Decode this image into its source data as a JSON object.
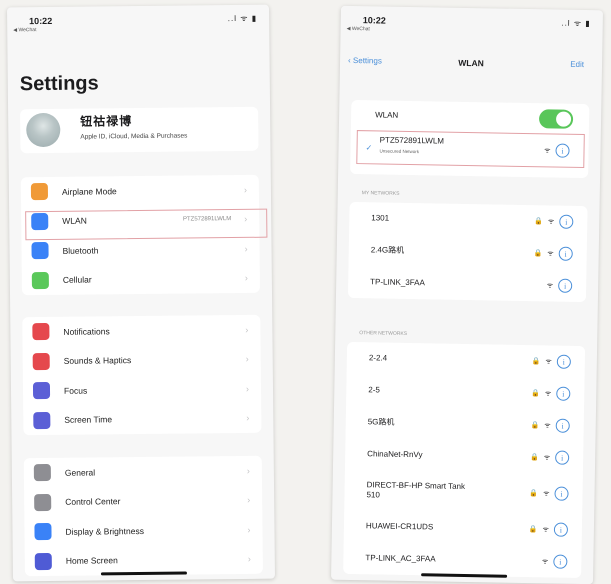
{
  "left": {
    "status": {
      "time": "10:22",
      "carrier": "◀ WeChat",
      "icons": "..l ᯤ ▮"
    },
    "title": "Settings",
    "profile": {
      "name": "钮祜禄博",
      "subtitle": "Apple ID, iCloud, Media & Purchases"
    },
    "groups": [
      [
        {
          "label": "Airplane Mode",
          "icon": "airplane-icon",
          "color": "#f09a37"
        },
        {
          "label": "WLAN",
          "icon": "wifi-icon",
          "color": "#3a82f7",
          "value": "PTZ572891LWLM"
        },
        {
          "label": "Bluetooth",
          "icon": "bluetooth-icon",
          "color": "#3a82f7"
        },
        {
          "label": "Cellular",
          "icon": "antenna-icon",
          "color": "#5ac85a"
        }
      ],
      [
        {
          "label": "Notifications",
          "icon": "bell-icon",
          "color": "#e5484d"
        },
        {
          "label": "Sounds & Haptics",
          "icon": "speaker-icon",
          "color": "#e5484d"
        },
        {
          "label": "Focus",
          "icon": "moon-icon",
          "color": "#5b5fd6"
        },
        {
          "label": "Screen Time",
          "icon": "hourglass-icon",
          "color": "#5b5fd6"
        }
      ],
      [
        {
          "label": "General",
          "icon": "gear-icon",
          "color": "#8e8e93"
        },
        {
          "label": "Control Center",
          "icon": "switches-icon",
          "color": "#8e8e93"
        },
        {
          "label": "Display & Brightness",
          "icon": "aa-icon",
          "color": "#3a82f7"
        },
        {
          "label": "Home Screen",
          "icon": "grid-icon",
          "color": "#4f5bd5"
        }
      ]
    ]
  },
  "right": {
    "status": {
      "time": "10:22",
      "carrier": "◀ WeChat",
      "icons": "..l ᯤ ▮"
    },
    "nav": {
      "back": "‹ Settings",
      "title": "WLAN",
      "edit": "Edit"
    },
    "wlan_label": "WLAN",
    "connected": {
      "name": "PTZ572891LWLM",
      "status": "Unsecured Network"
    },
    "networks_header": "MY NETWORKS",
    "networks": [
      {
        "name": "1301",
        "lock": true
      },
      {
        "name": "2.4G路机",
        "lock": true
      },
      {
        "name": "TP-LINK_3FAA",
        "lock": false
      }
    ],
    "other_header": "OTHER NETWORKS",
    "other_networks": [
      {
        "name": "2-2.4",
        "lock": true
      },
      {
        "name": "2-5",
        "lock": true
      },
      {
        "name": "5G路机",
        "lock": true
      },
      {
        "name": "ChinaNet-RnVy",
        "lock": true
      },
      {
        "name": "DIRECT-BF-HP Smart Tank 510",
        "lock": true
      },
      {
        "name": "HUAWEI-CR1UDS",
        "lock": true
      },
      {
        "name": "TP-LINK_AC_3FAA",
        "lock": false
      }
    ]
  }
}
